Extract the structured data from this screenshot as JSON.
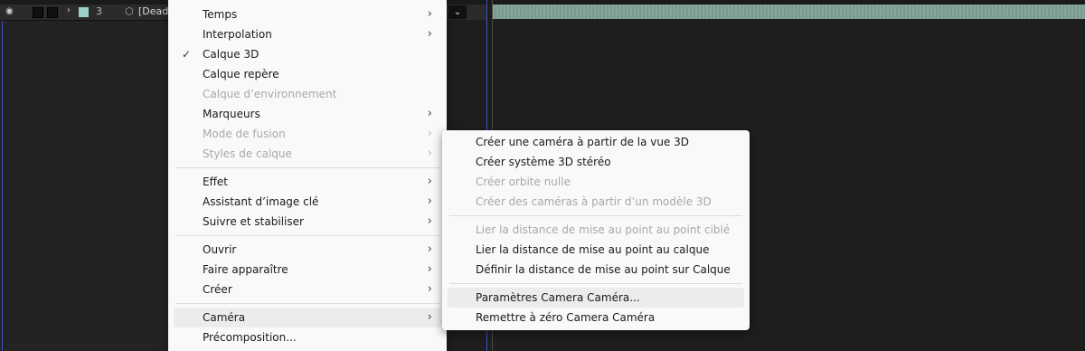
{
  "timeline": {
    "layer_number": "3",
    "layer_name": "[Dead",
    "eye_icon": "eye-icon",
    "chip_color": "#9ed0c8",
    "bar_color": "#7fa097"
  },
  "context_menu": {
    "items": [
      {
        "label": "Temps",
        "submenu": true,
        "disabled": false
      },
      {
        "label": "Interpolation",
        "submenu": true,
        "disabled": false
      },
      {
        "label": "Calque 3D",
        "checked": true,
        "disabled": false
      },
      {
        "label": "Calque repère",
        "disabled": false
      },
      {
        "label": "Calque d’environnement",
        "disabled": true
      },
      {
        "label": "Marqueurs",
        "submenu": true,
        "disabled": false
      },
      {
        "label": "Mode de fusion",
        "submenu": true,
        "disabled": true
      },
      {
        "label": "Styles de calque",
        "submenu": true,
        "disabled": true
      },
      {
        "label": "Effet",
        "submenu": true,
        "disabled": false
      },
      {
        "label": "Assistant d’image clé",
        "submenu": true,
        "disabled": false
      },
      {
        "label": "Suivre et stabiliser",
        "submenu": true,
        "disabled": false
      },
      {
        "label": "Ouvrir",
        "submenu": true,
        "disabled": false
      },
      {
        "label": "Faire apparaître",
        "submenu": true,
        "disabled": false
      },
      {
        "label": "Créer",
        "submenu": true,
        "disabled": false
      },
      {
        "label": "Caméra",
        "submenu": true,
        "disabled": false,
        "highlighted": true
      },
      {
        "label": "Précomposition...",
        "disabled": false
      }
    ]
  },
  "camera_submenu": {
    "items": [
      {
        "label": "Créer une caméra à partir de la vue 3D",
        "disabled": false
      },
      {
        "label": "Créer système 3D stéréo",
        "disabled": false
      },
      {
        "label": "Créer orbite nulle",
        "disabled": true
      },
      {
        "label": "Créer des caméras à partir d’un modèle 3D",
        "disabled": true
      },
      {
        "label": "Lier la distance de mise au point au point ciblé",
        "disabled": true
      },
      {
        "label": "Lier la distance de mise au point au calque",
        "disabled": false
      },
      {
        "label": "Définir la distance de mise au point sur Calque",
        "disabled": false
      },
      {
        "label": "Paramètres Camera Caméra...",
        "disabled": false,
        "highlighted": true
      },
      {
        "label": "Remettre à zéro Camera Caméra",
        "disabled": false
      }
    ]
  },
  "glyphs": {
    "check": "✓",
    "arrow": "›",
    "expand": "›",
    "chevron_down": "⌄",
    "cube": "⬡",
    "eye": "◉"
  }
}
